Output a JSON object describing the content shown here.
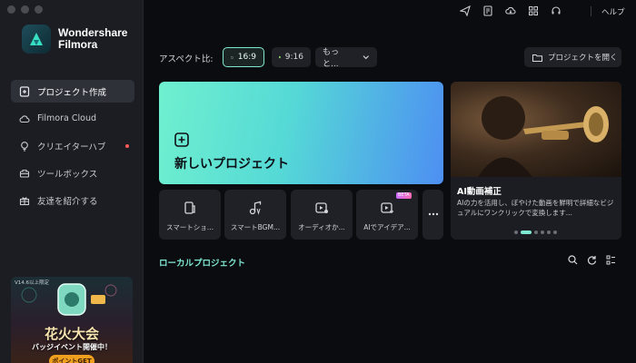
{
  "app": {
    "name_line1": "Wondershare",
    "name_line2": "Filmora"
  },
  "sidebar": {
    "items": [
      {
        "label": "プロジェクト作成",
        "icon": "new-project-icon",
        "active": true
      },
      {
        "label": "Filmora Cloud",
        "icon": "cloud-icon"
      },
      {
        "label": "クリエイターハブ",
        "icon": "bulb-icon",
        "badge": true
      },
      {
        "label": "ツールボックス",
        "icon": "toolbox-icon"
      },
      {
        "label": "友達を紹介する",
        "icon": "gift-icon"
      }
    ],
    "promo": {
      "note": "V14.6以上限定",
      "title": "花火大会",
      "subtitle": "バッジイベント開催中！",
      "button": "ポイントGET"
    }
  },
  "topbar": {
    "icons": [
      "send-icon",
      "document-icon",
      "cloud-download-icon",
      "grid-icon",
      "headset-icon"
    ],
    "help": "ヘルプ"
  },
  "aspect": {
    "label": "アスペクト比:",
    "options": [
      {
        "label": "16:9",
        "selected": true
      },
      {
        "label": "9:16"
      },
      {
        "label": "もっと..."
      }
    ]
  },
  "open_project": {
    "label": "プロジェクトを開く"
  },
  "new_project": {
    "label": "新しいプロジェクト"
  },
  "hero": {
    "title": "AI動画補正",
    "description": "AIの力を活用し、ぼやけた動画を鮮明で詳細なビジュアルにワンクリックで変換します..."
  },
  "tools": [
    {
      "label": "スマートショ...",
      "icon": "smart-short-icon"
    },
    {
      "label": "スマートBGM...",
      "icon": "smart-bgm-icon"
    },
    {
      "label": "オーディオか...",
      "icon": "audio-to-video-icon"
    },
    {
      "label": "AIでアイデア...",
      "icon": "ai-idea-icon",
      "badge": "BETA"
    }
  ],
  "local_projects": {
    "title": "ローカルプロジェクト"
  },
  "colors": {
    "accent": "#7fe8d2",
    "sidebar_bg": "#1b1d22",
    "bg": "#0b0c10"
  }
}
